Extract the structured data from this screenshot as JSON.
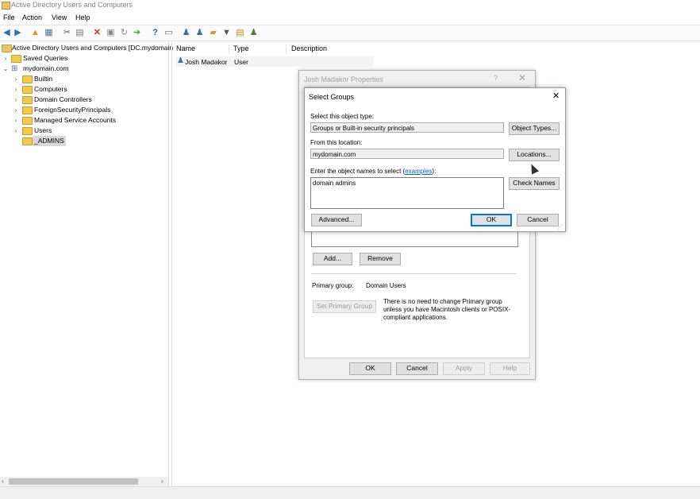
{
  "window": {
    "title": "Active Directory Users and Computers"
  },
  "menu": [
    "File",
    "Action",
    "View",
    "Help"
  ],
  "toolbar": {
    "icons": [
      "back-icon",
      "forward-icon",
      "up-icon",
      "show-hide-tree-icon",
      "cut-icon",
      "copy-icon",
      "delete-icon",
      "properties-icon",
      "refresh-icon",
      "export-icon",
      "help-icon",
      "console-icon",
      "new-user-icon",
      "new-group-icon",
      "new-ou-icon",
      "filter-icon",
      "find-icon",
      "add-to-group-icon"
    ]
  },
  "tree": {
    "root": "Active Directory Users and Computers [DC.mydomain",
    "items": [
      {
        "label": "Saved Queries",
        "expander": "›"
      },
      {
        "label": "mydomain.com",
        "expander": "⌄"
      },
      {
        "label": "Builtin",
        "expander": "›"
      },
      {
        "label": "Computers",
        "expander": "›"
      },
      {
        "label": "Domain Controllers",
        "expander": "›"
      },
      {
        "label": "ForeignSecurityPrincipals",
        "expander": "›"
      },
      {
        "label": "Managed Service Accounts",
        "expander": "›"
      },
      {
        "label": "Users",
        "expander": "›"
      },
      {
        "label": "_ADMINS",
        "expander": ""
      }
    ]
  },
  "list": {
    "headers": [
      "Name",
      "Type",
      "Description"
    ],
    "rows": [
      {
        "name": "Josh Madakor",
        "type": "User",
        "description": ""
      }
    ]
  },
  "properties_dialog": {
    "title": "Josh Madakor Properties",
    "help_glyph": "?",
    "close_glyph": "✕",
    "add_label": "Add...",
    "remove_label": "Remove",
    "primary_group_label": "Primary group:",
    "primary_group_value": "Domain Users",
    "set_primary_label": "Set Primary Group",
    "note": "There is no need to change Primary group unless you have Macintosh clients or POSIX-compliant applications.",
    "ok_label": "OK",
    "cancel_label": "Cancel",
    "apply_label": "Apply",
    "help_label": "Help"
  },
  "select_groups_dialog": {
    "title": "Select Groups",
    "close_glyph": "✕",
    "object_type_label": "Select this object type:",
    "object_type_value": "Groups or Built-in security principals",
    "object_types_button": "Object Types...",
    "location_label": "From this location:",
    "location_value": "mydomain.com",
    "locations_button": "Locations...",
    "names_label": "Enter the object names to select (",
    "names_label_link": "examples",
    "names_label_end": "):",
    "names_value": "domain admins",
    "check_names_button": "Check Names",
    "advanced_button": "Advanced...",
    "ok_button": "OK",
    "cancel_button": "Cancel"
  }
}
